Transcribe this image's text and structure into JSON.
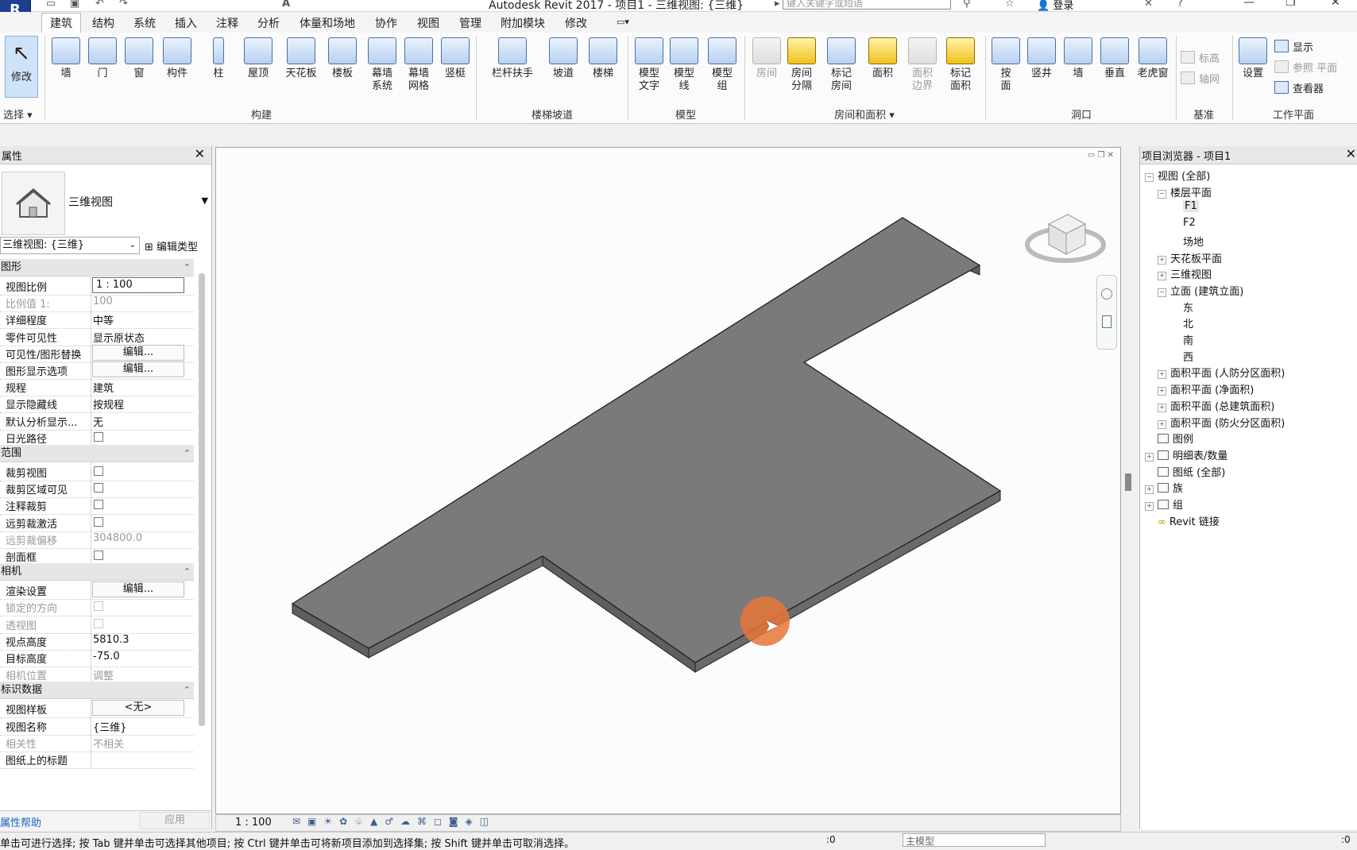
{
  "app": {
    "title": "Autodesk Revit 2017 -    项目1 - 三维视图: {三维}",
    "search_placeholder": "键入关键字或短语",
    "login": "登录",
    "logo_letter": "R"
  },
  "tabs": [
    "建筑",
    "结构",
    "系统",
    "插入",
    "注释",
    "分析",
    "体量和场地",
    "协作",
    "视图",
    "管理",
    "附加模块",
    "修改"
  ],
  "ribbon": {
    "select": {
      "modify": "修改",
      "panel": "选择"
    },
    "build": {
      "panel": "构建",
      "buttons": [
        "墙",
        "门",
        "窗",
        "构件",
        "柱",
        "屋顶",
        "天花板",
        "楼板",
        "幕墙\n系统",
        "幕墙\n网格",
        "竖梃"
      ]
    },
    "circulation": {
      "panel": "楼梯坡道",
      "buttons": [
        "栏杆扶手",
        "坡道",
        "楼梯"
      ]
    },
    "model": {
      "panel": "模型",
      "buttons": [
        "模型\n文字",
        "模型\n线",
        "模型\n组"
      ]
    },
    "room": {
      "panel": "房间和面积",
      "buttons": [
        "房间",
        "房间\n分隔",
        "标记\n房间",
        "面积",
        "面积\n边界",
        "标记\n面积"
      ]
    },
    "opening": {
      "panel": "洞口",
      "buttons": [
        "按\n面",
        "竖井",
        "墙",
        "垂直",
        "老虎窗"
      ]
    },
    "datum": {
      "panel": "基准",
      "buttons": [
        "标高",
        "轴网"
      ]
    },
    "workplane": {
      "panel": "工作平面",
      "set": "设置",
      "buttons": [
        "显示",
        "参照 平面",
        "查看器"
      ]
    }
  },
  "properties": {
    "title": "属性",
    "type_name": "三维视图",
    "instance_selector": "三维视图: {三维}",
    "edit_type": "编辑类型",
    "groups": [
      {
        "name": "图形",
        "rows": [
          {
            "k": "视图比例",
            "v": "1 : 100",
            "kind": "input"
          },
          {
            "k": "比例值 1:",
            "v": "100",
            "kind": "text",
            "dim": true
          },
          {
            "k": "详细程度",
            "v": "中等",
            "kind": "text"
          },
          {
            "k": "零件可见性",
            "v": "显示原状态",
            "kind": "text"
          },
          {
            "k": "可见性/图形替换",
            "v": "编辑...",
            "kind": "button"
          },
          {
            "k": "图形显示选项",
            "v": "编辑...",
            "kind": "button"
          },
          {
            "k": "规程",
            "v": "建筑",
            "kind": "text"
          },
          {
            "k": "显示隐藏线",
            "v": "按规程",
            "kind": "text"
          },
          {
            "k": "默认分析显示...",
            "v": "无",
            "kind": "text"
          },
          {
            "k": "日光路径",
            "v": "",
            "kind": "check"
          }
        ]
      },
      {
        "name": "范围",
        "rows": [
          {
            "k": "裁剪视图",
            "v": "",
            "kind": "check"
          },
          {
            "k": "裁剪区域可见",
            "v": "",
            "kind": "check"
          },
          {
            "k": "注释裁剪",
            "v": "",
            "kind": "check"
          },
          {
            "k": "远剪裁激活",
            "v": "",
            "kind": "check"
          },
          {
            "k": "远剪裁偏移",
            "v": "304800.0",
            "kind": "text",
            "dim": true
          },
          {
            "k": "剖面框",
            "v": "",
            "kind": "check"
          }
        ]
      },
      {
        "name": "相机",
        "rows": [
          {
            "k": "渲染设置",
            "v": "编辑...",
            "kind": "button"
          },
          {
            "k": "锁定的方向",
            "v": "",
            "kind": "check",
            "dim": true
          },
          {
            "k": "透视图",
            "v": "",
            "kind": "check",
            "dim": true
          },
          {
            "k": "视点高度",
            "v": "5810.3",
            "kind": "text"
          },
          {
            "k": "目标高度",
            "v": "-75.0",
            "kind": "text"
          },
          {
            "k": "相机位置",
            "v": "调整",
            "kind": "text",
            "dim": true
          }
        ]
      },
      {
        "name": "标识数据",
        "rows": [
          {
            "k": "视图样板",
            "v": "<无>",
            "kind": "button"
          },
          {
            "k": "视图名称",
            "v": "{三维}",
            "kind": "text"
          },
          {
            "k": "相关性",
            "v": "不相关",
            "kind": "text",
            "dim": true
          },
          {
            "k": "图纸上的标题",
            "v": "",
            "kind": "text"
          }
        ]
      }
    ],
    "help": "属性帮助",
    "apply": "应用"
  },
  "viewport": {
    "scale": "1 : 100"
  },
  "browser": {
    "title": "项目浏览器 - 项目1",
    "nodes": [
      {
        "label": "视图 (全部)",
        "level": 0,
        "toggle": "-"
      },
      {
        "label": "楼层平面",
        "level": 1,
        "toggle": "-"
      },
      {
        "label": "F1",
        "level": 2,
        "selected": true
      },
      {
        "label": "F2",
        "level": 2
      },
      {
        "label": "场地",
        "level": 2
      },
      {
        "label": "天花板平面",
        "level": 1,
        "toggle": "+"
      },
      {
        "label": "三维视图",
        "level": 1,
        "toggle": "+"
      },
      {
        "label": "立面 (建筑立面)",
        "level": 1,
        "toggle": "-"
      },
      {
        "label": "东",
        "level": 2
      },
      {
        "label": "北",
        "level": 2
      },
      {
        "label": "南",
        "level": 2
      },
      {
        "label": "西",
        "level": 2
      },
      {
        "label": "面积平面 (人防分区面积)",
        "level": 1,
        "toggle": "+"
      },
      {
        "label": "面积平面 (净面积)",
        "level": 1,
        "toggle": "+"
      },
      {
        "label": "面积平面 (总建筑面积)",
        "level": 1,
        "toggle": "+"
      },
      {
        "label": "面积平面 (防火分区面积)",
        "level": 1,
        "toggle": "+"
      },
      {
        "label": "图例",
        "level": 0,
        "icon": true
      },
      {
        "label": "明细表/数量",
        "level": 0,
        "toggle": "+",
        "icon": true
      },
      {
        "label": "图纸 (全部)",
        "level": 0,
        "icon": true
      },
      {
        "label": "族",
        "level": 0,
        "toggle": "+",
        "icon": true
      },
      {
        "label": "组",
        "level": 0,
        "toggle": "+",
        "icon": true
      },
      {
        "label": "Revit 链接",
        "level": 0,
        "link": true
      }
    ]
  },
  "status": {
    "message": "单击可进行选择; 按 Tab 键并单击可选择其他项目; 按 Ctrl 键并单击可将新项目添加到选择集; 按 Shift 键并单击可取消选择。",
    "workset": "主模型",
    "count_left": ":0",
    "count_right": ":0"
  },
  "colors": {
    "accent": "#1d3f8c",
    "floor": "#7a7a7a",
    "cursor_highlight": "#e8763a"
  }
}
